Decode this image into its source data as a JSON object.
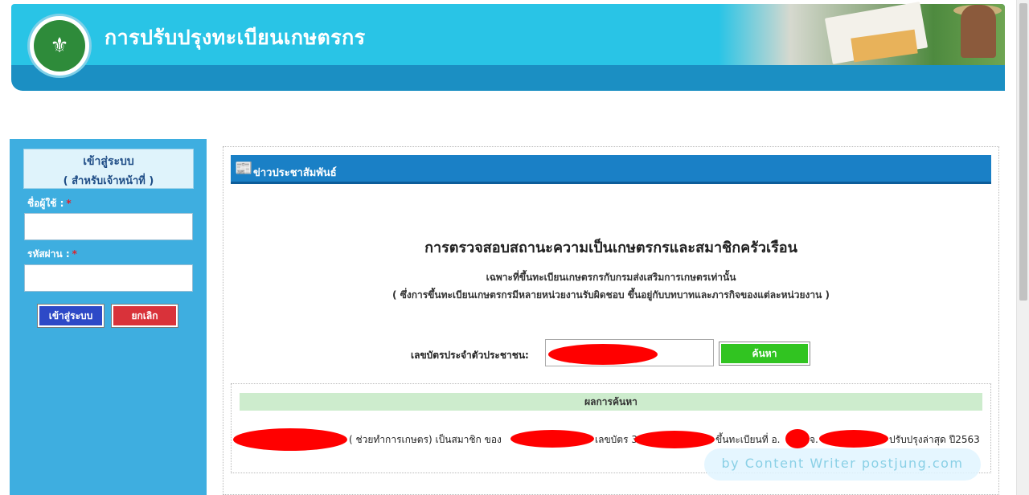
{
  "header": {
    "site_title": "การปรับปรุงทะเบียนเกษตรกร",
    "logo_icon": "ministry-seal-icon"
  },
  "login": {
    "heading_line1": "เข้าสู่ระบบ",
    "heading_line2": "( สำหรับเจ้าหน้าที่ )",
    "username_label": "ชื่อผู้ใช้ :",
    "username_value": "",
    "password_label": "รหัสผ่าน :",
    "password_value": "",
    "required_mark": "*",
    "login_button": "เข้าสู่ระบบ",
    "cancel_button": "ยกเลิก"
  },
  "news": {
    "section_title": "ข่าวประชาสัมพันธ์",
    "section_icon": "newspaper-icon"
  },
  "check": {
    "title": "การตรวจสอบสถานะความเป็นเกษตรกรและสมาชิกครัวเรือน",
    "subtitle1": "เฉพาะที่ขึ้นทะเบียนเกษตรกรกับกรมส่งเสริมการเกษตรเท่านั้น",
    "subtitle2": "( ซึ่งการขึ้นทะเบียนเกษตรกรมีหลายหน่วยงานรับผิดชอบ ขึ้นอยู่กับบทบาทและภารกิจของแต่ละหน่วยงาน )",
    "id_label": "เลขบัตรประจำตัวประชาชน:",
    "id_value": "",
    "search_button": "ค้นหา"
  },
  "result": {
    "heading": "ผลการค้นหา",
    "seg_role": "( ช่วยทำการเกษตร) เป็นสมาชิก ของ",
    "seg_card": "เลขบัตร 3",
    "seg_reg": "ขึ้นทะเบียนที่ อ.",
    "seg_prov": "จ.",
    "seg_update": "ปรับปรุงล่าสุด ปี2563"
  },
  "watermark": "by  Content  Writer  postjung.com",
  "colors": {
    "banner": "#29c4e6",
    "banner_band": "#1b8fc3",
    "sidebar": "#3eaee0",
    "news_bar": "#1a80c6",
    "search_button": "#31c421",
    "login_button": "#2d49c7",
    "cancel_button": "#d9323a",
    "redaction": "#ff0000"
  }
}
